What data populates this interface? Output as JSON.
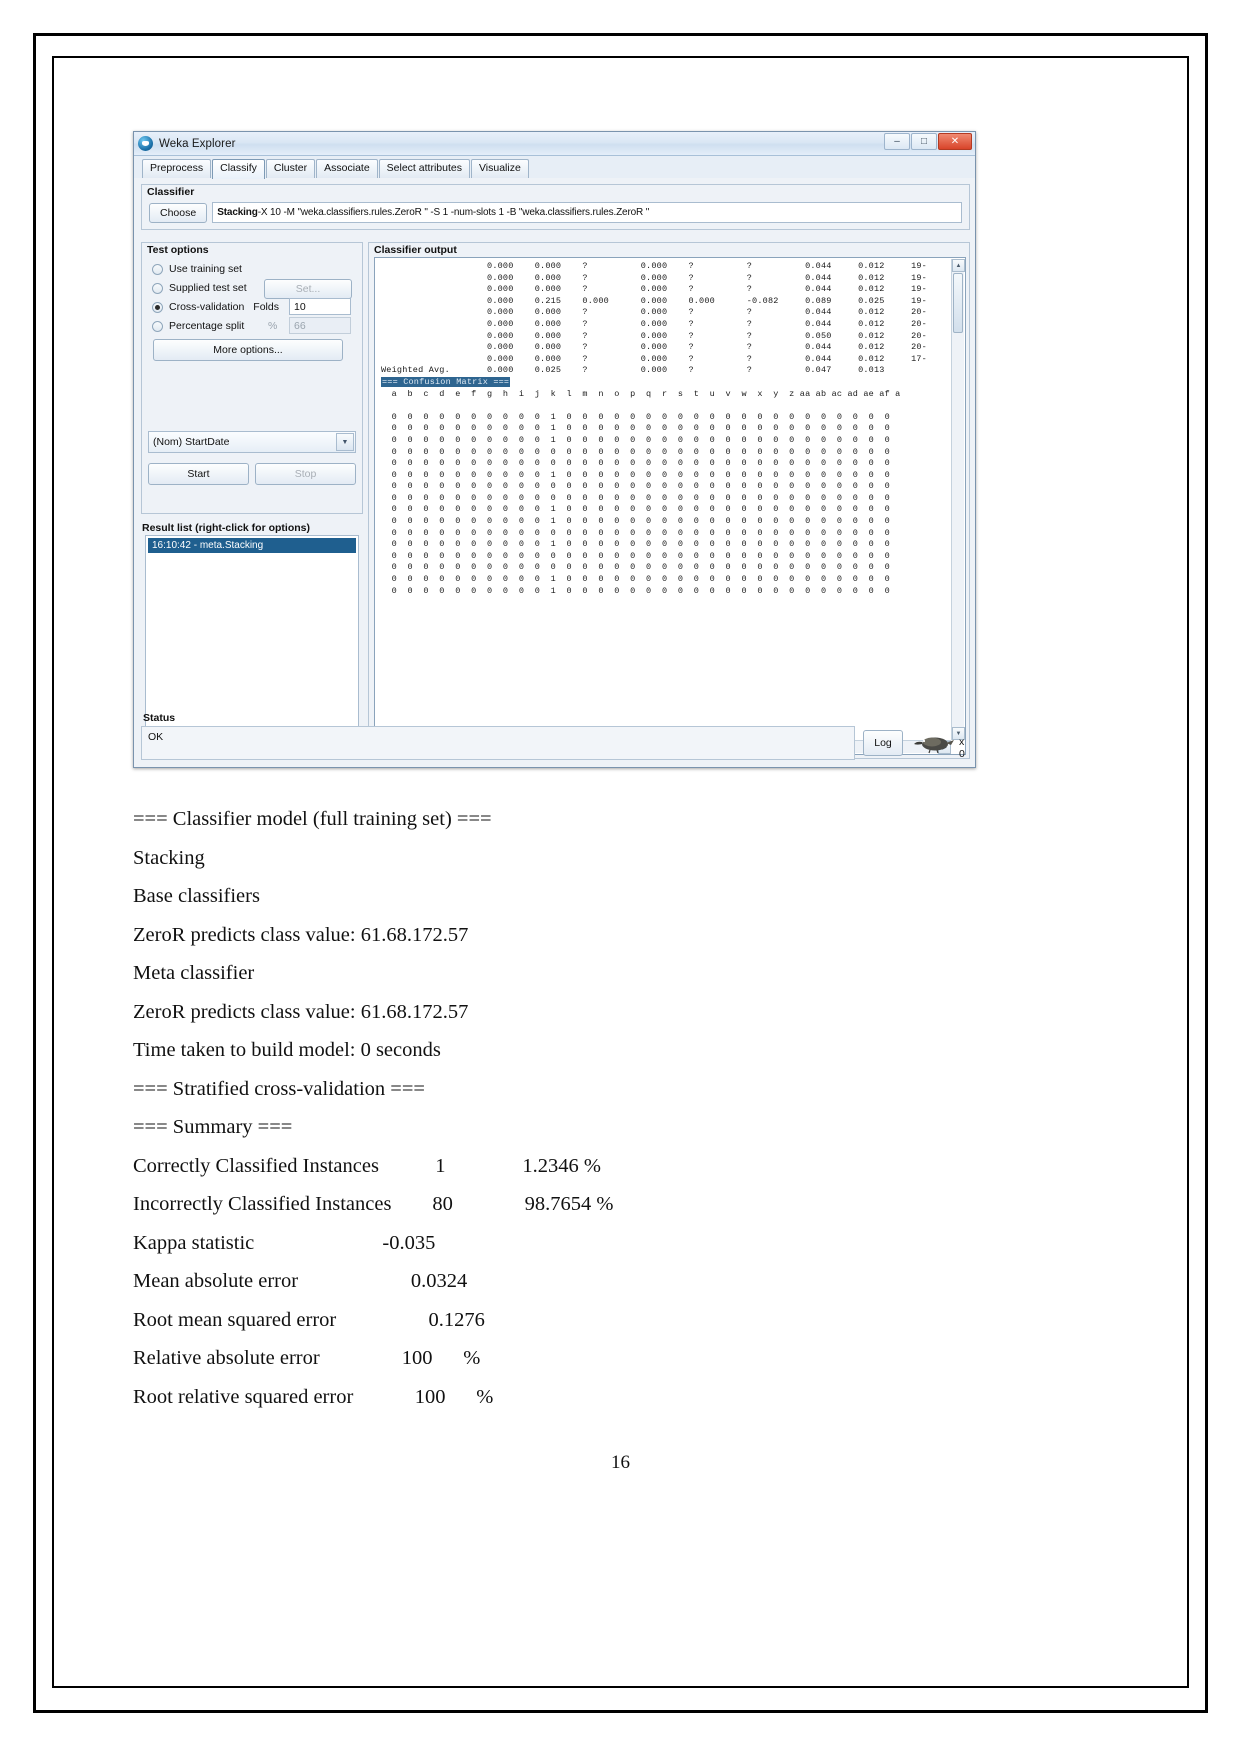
{
  "window": {
    "title": "Weka Explorer",
    "buttons": {
      "minimize": "–",
      "maximize": "□",
      "close": "✕"
    },
    "tabs": [
      {
        "label": "Preprocess",
        "active": false
      },
      {
        "label": "Classify",
        "active": true
      },
      {
        "label": "Cluster",
        "active": false
      },
      {
        "label": "Associate",
        "active": false
      },
      {
        "label": "Select attributes",
        "active": false
      },
      {
        "label": "Visualize",
        "active": false
      }
    ]
  },
  "classifier": {
    "group_label": "Classifier",
    "choose_button": "Choose",
    "scheme_name": "Stacking",
    "scheme_options": " -X 10 -M \"weka.classifiers.rules.ZeroR \" -S 1 -num-slots 1 -B \"weka.classifiers.rules.ZeroR \""
  },
  "test_options": {
    "group_label": "Test options",
    "use_training_set": "Use training set",
    "supplied_test_set": "Supplied test set",
    "set_button": "Set...",
    "cross_validation": "Cross-validation",
    "folds_label": "Folds",
    "folds_value": "10",
    "percentage_split": "Percentage split",
    "percent_label": "%",
    "percent_value": "66",
    "more_options": "More options...",
    "class_attribute": "(Nom) StartDate",
    "start_button": "Start",
    "stop_button": "Stop"
  },
  "result_list": {
    "label": "Result list (right-click for options)",
    "items": [
      "16:10:42 - meta.Stacking"
    ]
  },
  "classifier_output": {
    "group_label": "Classifier output",
    "text": "                    0.000    0.000    ?          0.000    ?          ?          0.044     0.012     19-\n                    0.000    0.000    ?          0.000    ?          ?          0.044     0.012     19-\n                    0.000    0.000    ?          0.000    ?          ?          0.044     0.012     19-\n                    0.000    0.215    0.000      0.000    0.000      -0.082     0.089     0.025     19-\n                    0.000    0.000    ?          0.000    ?          ?          0.044     0.012     20-\n                    0.000    0.000    ?          0.000    ?          ?          0.044     0.012     20-\n                    0.000    0.000    ?          0.000    ?          ?          0.050     0.012     20-\n                    0.000    0.000    ?          0.000    ?          ?          0.044     0.012     20-\n                    0.000    0.000    ?          0.000    ?          ?          0.044     0.012     17-\nWeighted Avg.       0.000    0.025    ?          0.000    ?          ?          0.047     0.013",
    "confusion_title": "=== Confusion Matrix ===",
    "matrix_header": "  a  b  c  d  e  f  g  h  i  j  k  l  m  n  o  p  q  r  s  t  u  v  w  x  y  z aa ab ac ad ae af a",
    "matrix_rows": [
      "  0  0  0  0  0  0  0  0  0  0  1  0  0  0  0  0  0  0  0  0  0  0  0  0  0  0  0  0  0  0  0  0",
      "  0  0  0  0  0  0  0  0  0  0  1  0  0  0  0  0  0  0  0  0  0  0  0  0  0  0  0  0  0  0  0  0",
      "  0  0  0  0  0  0  0  0  0  0  1  0  0  0  0  0  0  0  0  0  0  0  0  0  0  0  0  0  0  0  0  0",
      "  0  0  0  0  0  0  0  0  0  0  0  0  0  0  0  0  0  0  0  0  0  0  0  0  0  0  0  0  0  0  0  0",
      "  0  0  0  0  0  0  0  0  0  0  0  0  0  0  0  0  0  0  0  0  0  0  0  0  0  0  0  0  0  0  0  0",
      "  0  0  0  0  0  0  0  0  0  0  1  0  0  0  0  0  0  0  0  0  0  0  0  0  0  0  0  0  0  0  0  0",
      "  0  0  0  0  0  0  0  0  0  0  0  0  0  0  0  0  0  0  0  0  0  0  0  0  0  0  0  0  0  0  0  0",
      "  0  0  0  0  0  0  0  0  0  0  0  0  0  0  0  0  0  0  0  0  0  0  0  0  0  0  0  0  0  0  0  0",
      "  0  0  0  0  0  0  0  0  0  0  1  0  0  0  0  0  0  0  0  0  0  0  0  0  0  0  0  0  0  0  0  0",
      "  0  0  0  0  0  0  0  0  0  0  1  0  0  0  0  0  0  0  0  0  0  0  0  0  0  0  0  0  0  0  0  0",
      "  0  0  0  0  0  0  0  0  0  0  0  0  0  0  0  0  0  0  0  0  0  0  0  0  0  0  0  0  0  0  0  0",
      "  0  0  0  0  0  0  0  0  0  0  1  0  0  0  0  0  0  0  0  0  0  0  0  0  0  0  0  0  0  0  0  0",
      "  0  0  0  0  0  0  0  0  0  0  0  0  0  0  0  0  0  0  0  0  0  0  0  0  0  0  0  0  0  0  0  0",
      "  0  0  0  0  0  0  0  0  0  0  0  0  0  0  0  0  0  0  0  0  0  0  0  0  0  0  0  0  0  0  0  0",
      "  0  0  0  0  0  0  0  0  0  0  1  0  0  0  0  0  0  0  0  0  0  0  0  0  0  0  0  0  0  0  0  0",
      "  0  0  0  0  0  0  0  0  0  0  1  0  0  0  0  0  0  0  0  0  0  0  0  0  0  0  0  0  0  0  0  0"
    ]
  },
  "status": {
    "group_label": "Status",
    "text": "OK",
    "log_button": "Log",
    "bird_counter": "x 0"
  },
  "document": {
    "lines": [
      "=== Classifier model (full training set) ===",
      "Stacking",
      "Base classifiers",
      "ZeroR predicts class value: 61.68.172.57",
      "Meta classifier",
      "ZeroR predicts class value: 61.68.172.57",
      "Time taken to build model: 0 seconds",
      "=== Stratified cross-validation ===",
      "=== Summary ===",
      "Correctly Classified Instances           1               1.2346 %",
      "Incorrectly Classified Instances        80              98.7654 %",
      "Kappa statistic                         -0.035",
      "Mean absolute error                      0.0324",
      "Root mean squared error                  0.1276",
      "Relative absolute error                100      %",
      "Root relative squared error            100      %"
    ],
    "page_number": "16"
  }
}
